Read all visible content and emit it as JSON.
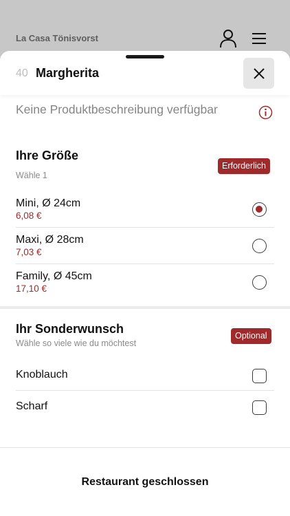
{
  "app": {
    "restaurant_name": "La Casa Tönisvorst"
  },
  "item": {
    "number": "40",
    "title": "Margherita",
    "description": "Keine Produktbeschreibung verfügbar"
  },
  "size_group": {
    "title": "Ihre Größe",
    "subtitle": "Wähle 1",
    "badge": "Erforderlich",
    "selected_index": 0,
    "options": [
      {
        "name": "Mini, Ø 24cm",
        "price": "6,08 €"
      },
      {
        "name": "Maxi, Ø 28cm",
        "price": "7,03 €"
      },
      {
        "name": "Family, Ø 45cm",
        "price": "17,10 €"
      }
    ]
  },
  "extras_group": {
    "title": "Ihr Sonderwunsch",
    "subtitle": "Wähle so viele wie du möchtest",
    "badge": "Optional",
    "options": [
      {
        "name": "Knoblauch",
        "checked": false
      },
      {
        "name": "Scharf",
        "checked": false
      }
    ]
  },
  "footer": {
    "status": "Restaurant geschlossen"
  },
  "colors": {
    "accent": "#9e2a2b",
    "backdrop": "#c7c7c7"
  },
  "icons": {
    "account": "user-icon",
    "menu": "menu-icon",
    "close": "close-icon",
    "info": "info-icon"
  }
}
